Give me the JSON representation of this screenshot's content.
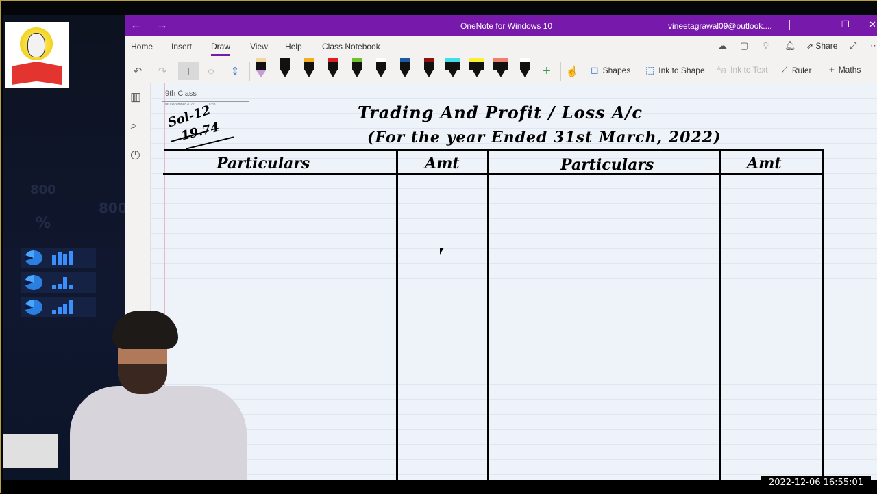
{
  "window": {
    "title": "OneNote for Windows 10",
    "user": "vineetagrawal09@outlook....",
    "back_icon": "←",
    "forward_icon": "→",
    "minimize_icon": "—",
    "restore_icon": "❐",
    "close_icon": "✕"
  },
  "ribbon": {
    "tabs": [
      {
        "label": "Home",
        "active": false
      },
      {
        "label": "Insert",
        "active": false
      },
      {
        "label": "Draw",
        "active": true
      },
      {
        "label": "View",
        "active": false
      },
      {
        "label": "Help",
        "active": false
      },
      {
        "label": "Class Notebook",
        "active": false
      }
    ],
    "share_label": "Share",
    "tools": {
      "undo_icon": "↶",
      "redo_icon": "↷",
      "select_icon": "I",
      "lasso_icon": "◌",
      "space_icon": "⇕",
      "add_pen_icon": "+",
      "touch_icon": "☝"
    },
    "pens": [
      {
        "name": "eraser",
        "cap": "#f0d8a0",
        "tip": "#c89ad8"
      },
      {
        "name": "black-pen",
        "cap": "#111111",
        "tip": "#111111"
      },
      {
        "name": "yellow-pen",
        "cap": "#f0b020",
        "tip": "#e0c040"
      },
      {
        "name": "red-pen",
        "cap": "#e02020",
        "tip": "#c02020"
      },
      {
        "name": "green-pen",
        "cap": "#70c030",
        "tip": "#60a030"
      },
      {
        "name": "black-pencil",
        "cap": "#ffffff",
        "tip": "#888888"
      },
      {
        "name": "blue-pen",
        "cap": "#1a5aa0",
        "tip": "#4a80c0"
      },
      {
        "name": "darkred-pen",
        "cap": "#901010",
        "tip": "#701010"
      },
      {
        "name": "cyan-highlighter",
        "cap": "#40e0e8",
        "tip": "#40e0e8"
      },
      {
        "name": "yellow-highlighter",
        "cap": "#f8f030",
        "tip": "#f0f020"
      },
      {
        "name": "salmon-highlighter",
        "cap": "#f08070",
        "tip": "#e08070"
      },
      {
        "name": "black-pen-2",
        "cap": "#ffffff",
        "tip": "#999999"
      }
    ],
    "right_tools": [
      {
        "label": "Shapes",
        "icon": "◻",
        "disabled": false
      },
      {
        "label": "Ink to Shape",
        "icon": "⬚",
        "disabled": false
      },
      {
        "label": "Ink to Text",
        "icon": "ᴬa",
        "disabled": true
      },
      {
        "label": "Ruler",
        "icon": "⟋",
        "disabled": false
      },
      {
        "label": "Maths",
        "icon": "±",
        "disabled": false
      }
    ]
  },
  "sidebar_icons": [
    "notebooks-icon",
    "search-icon",
    "recent-icon"
  ],
  "page": {
    "title": "9th Class",
    "date": "06 December 2022",
    "time": "18:38",
    "ink": {
      "solution_ref": "Sol-12",
      "page_ref": "19.74",
      "heading_line1": "Trading And Profit / Loss A/c",
      "heading_line2": "(For the year Ended 31st March, 2022)",
      "columns": [
        "Particulars",
        "Amt",
        "Particulars",
        "Amt"
      ]
    }
  },
  "overlay": {
    "timestamp": "2022-12-06  16:55:01"
  }
}
